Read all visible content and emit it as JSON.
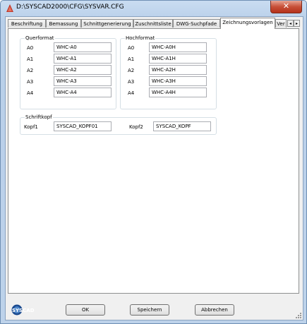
{
  "window": {
    "title": "D:\\SYSCAD2000\\CFG\\SYSVAR.CFG",
    "close_glyph": "✕"
  },
  "tabs": [
    {
      "label": "Beschriftung"
    },
    {
      "label": "Bemassung"
    },
    {
      "label": "Schnittgenerierung"
    },
    {
      "label": "Zuschnittsliste"
    },
    {
      "label": "DWG-Suchpfade"
    },
    {
      "label": "Zeichnungsvorlagen",
      "active": true
    },
    {
      "label": "Ver"
    }
  ],
  "tab_scroll": {
    "left": "◂",
    "right": "▸"
  },
  "querformat": {
    "title": "Querformat",
    "rows": [
      {
        "label": "A0",
        "value": "WHC-A0"
      },
      {
        "label": "A1",
        "value": "WHC-A1"
      },
      {
        "label": "A2",
        "value": "WHC-A2"
      },
      {
        "label": "A3",
        "value": "WHC-A3"
      },
      {
        "label": "A4",
        "value": "WHC-A4"
      }
    ]
  },
  "hochformat": {
    "title": "Hochformat",
    "rows": [
      {
        "label": "A0",
        "value": "WHC-A0H"
      },
      {
        "label": "A1",
        "value": "WHC-A1H"
      },
      {
        "label": "A2",
        "value": "WHC-A2H"
      },
      {
        "label": "A3",
        "value": "WHC-A3H"
      },
      {
        "label": "A4",
        "value": "WHC-A4H"
      }
    ]
  },
  "schriftkopf": {
    "title": "Schriftkopf",
    "kopf1_label": "Kopf1",
    "kopf1_value": "SYSCAD_KOPF01",
    "kopf2_label": "Kopf2",
    "kopf2_value": "SYSCAD_KOPF"
  },
  "buttons": {
    "ok": "OK",
    "save": "Speichern",
    "cancel": "Abbrechen"
  },
  "logo_text": "SYSCAD",
  "colors": {
    "accent": "#1a4a8f",
    "close_red": "#c75038",
    "app_icon_red": "#c0392b"
  }
}
